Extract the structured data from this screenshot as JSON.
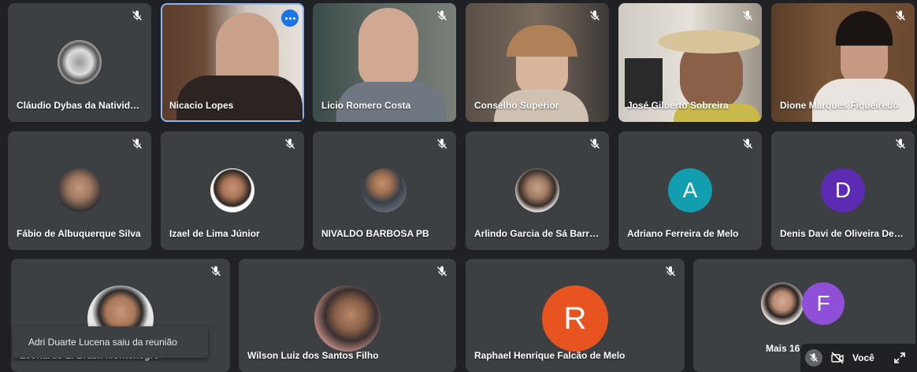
{
  "participants": [
    {
      "name": "Cláudio Dybas da Natividade"
    },
    {
      "name": "Nicacio Lopes"
    },
    {
      "name": "Licio Romero Costa"
    },
    {
      "name": "Conselho Superior"
    },
    {
      "name": "José Gilberto Sobreira"
    },
    {
      "name": "Dione Marques Figueiredo"
    },
    {
      "name": "Fábio de Albuquerque Silva"
    },
    {
      "name": "Izael de Lima Júnior"
    },
    {
      "name": "NIVALDO BARBOSA PB"
    },
    {
      "name": "Arlindo Garcia de Sá Barreto"
    },
    {
      "name": "Adriano Ferreira de Melo",
      "initial": "A"
    },
    {
      "name": "Denis Davi de Oliveira Decker",
      "initial": "D"
    },
    {
      "name": "Leonardo L. Brasil Montenegro"
    },
    {
      "name": "Wilson Luiz dos Santos Filho"
    },
    {
      "name": "Raphael Henrique Falcão de Melo",
      "initial": "R"
    }
  ],
  "overflow": {
    "label": "Mais 16",
    "initial": "F"
  },
  "toast": {
    "text": "Adri Duarte Lucena saiu da reunião"
  },
  "self_view": {
    "label": "Você"
  },
  "colors": {
    "background": "#202124",
    "tile": "#3c4043",
    "active_border": "#8ab4f8",
    "avatar_teal": "#129eaf",
    "avatar_purple": "#5b2bb3",
    "avatar_orange": "#e8541f",
    "avatar_purple_light": "#8f4fd8"
  },
  "icons": [
    "mic-off-icon",
    "more-options-icon",
    "camera-off-icon",
    "expand-icon"
  ]
}
